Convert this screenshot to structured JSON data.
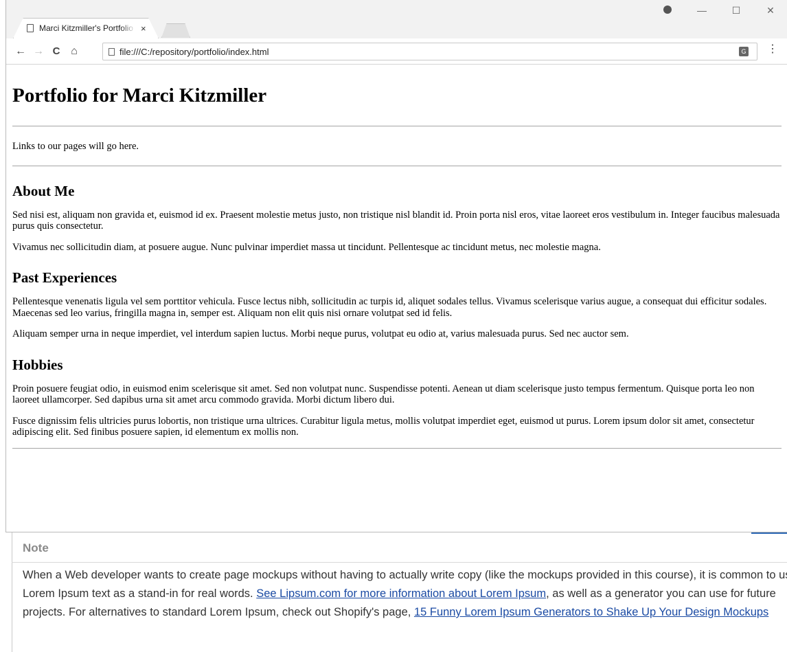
{
  "browser": {
    "tab_title": "Marci Kitzmiller's Portfolio",
    "tab_close": "×",
    "url": "file:///C:/repository/portfolio/index.html",
    "window_minimize": "—",
    "window_maximize": "☐",
    "window_close": "✕",
    "back": "←",
    "forward": "→",
    "reload": "C",
    "home": "⌂",
    "menu": "⋮"
  },
  "page": {
    "title": "Portfolio for Marci Kitzmiller",
    "links_text": "Links to our pages will go here.",
    "sections": [
      {
        "heading": "About Me",
        "paragraphs": [
          "Sed nisi est, aliquam non gravida et, euismod id ex. Praesent molestie metus justo, non tristique nisl blandit id. Proin porta nisl eros, vitae laoreet eros vestibulum in. Integer faucibus malesuada purus quis consectetur.",
          "Vivamus nec sollicitudin diam, at posuere augue. Nunc pulvinar imperdiet massa ut tincidunt. Pellentesque ac tincidunt metus, nec molestie magna."
        ]
      },
      {
        "heading": "Past Experiences",
        "paragraphs": [
          "Pellentesque venenatis ligula vel sem porttitor vehicula. Fusce lectus nibh, sollicitudin ac turpis id, aliquet sodales tellus. Vivamus scelerisque varius augue, a consequat dui efficitur sodales. Maecenas sed leo varius, fringilla magna in, semper est. Aliquam non elit quis nisi ornare volutpat sed id felis.",
          "Aliquam semper urna in neque imperdiet, vel interdum sapien luctus. Morbi neque purus, volutpat eu odio at, varius malesuada purus. Sed nec auctor sem."
        ]
      },
      {
        "heading": "Hobbies",
        "paragraphs": [
          "Proin posuere feugiat odio, in euismod enim scelerisque sit amet. Sed non volutpat nunc. Suspendisse potenti. Aenean ut diam scelerisque justo tempus fermentum. Quisque porta leo non laoreet ullamcorper. Sed dapibus urna sit amet arcu commodo gravida. Morbi dictum libero dui.",
          "Fusce dignissim felis ultricies purus lobortis, non tristique urna ultrices. Curabitur ligula metus, mollis volutpat imperdiet eget, euismod ut purus. Lorem ipsum dolor sit amet, consectetur adipiscing elit. Sed finibus posuere sapien, id elementum ex mollis non."
        ]
      }
    ]
  },
  "note": {
    "title": "Note",
    "text_1": "When a Web developer wants to create page mockups without having to actually write copy (like the mockups provided in this course), it is common to use Lorem Ipsum text as a stand-in for real words. ",
    "link_1": "See Lipsum.com for more information about Lorem Ipsum",
    "text_2": ", as well as a generator you can use for future projects. For alternatives to standard Lorem Ipsum, check out Shopify's page, ",
    "link_2": "15 Funny Lorem Ipsum Generators to Shake Up Your Design Mockups"
  },
  "colors": {
    "link": "#1a4aa3",
    "note_accent": "#2b67b5",
    "note_title": "#8a8a8a"
  }
}
